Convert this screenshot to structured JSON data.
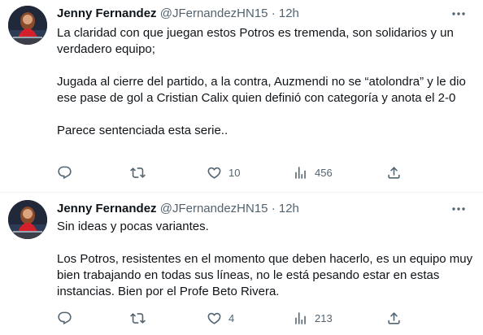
{
  "tweets": [
    {
      "author_name": "Jenny Fernandez",
      "handle": "@JFernandezHN15",
      "separator": "·",
      "time": "12h",
      "paragraphs": [
        "La claridad con que juegan estos Potros es tremenda, son solidarios y un verdadero equipo;",
        "Jugada al cierre del partido, a la contra, Auzmendi no se “atolondra” y le dio ese pase de gol a Cristian Calix quien definió con categoría y anota el 2-0",
        "Parece sentenciada esta serie.."
      ],
      "replies": "",
      "retweets": "",
      "likes": "10",
      "views": "456"
    },
    {
      "author_name": "Jenny Fernandez",
      "handle": "@JFernandezHN15",
      "separator": "·",
      "time": "12h",
      "paragraphs": [
        "Sin ideas y pocas variantes.",
        "Los Potros, resistentes en el momento que deben hacerlo, es un equipo muy bien trabajando en todas sus líneas, no le está pesando estar en estas instancias. Bien por el Profe Beto Rivera."
      ],
      "replies": "",
      "retweets": "",
      "likes": "4",
      "views": "213"
    }
  ],
  "icons": {
    "avatar": "profile-photo",
    "more": "more-dots-icon",
    "reply": "reply-bubble-icon",
    "retweet": "retweet-icon",
    "like": "heart-icon",
    "views": "bar-chart-icon",
    "share": "share-upload-icon"
  },
  "colors": {
    "text_primary": "#0f1419",
    "text_secondary": "#536471",
    "divider": "#eff3f4"
  }
}
